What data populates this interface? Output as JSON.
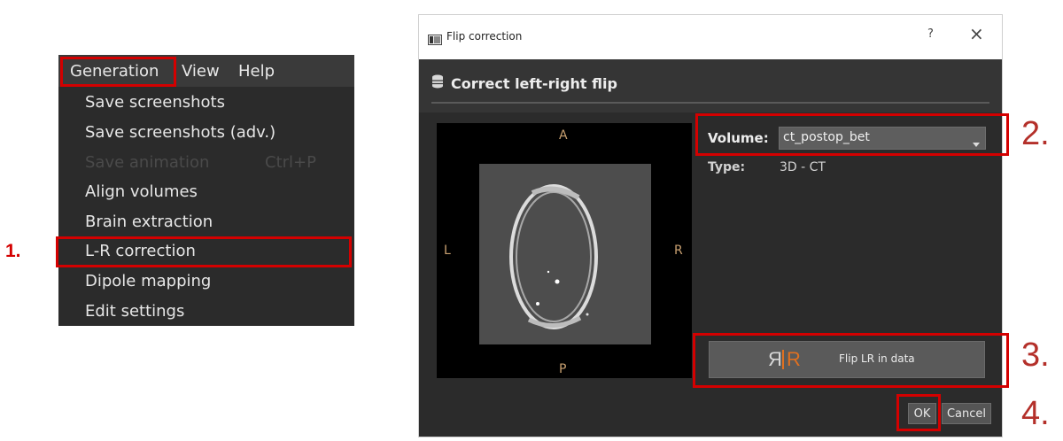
{
  "menu": {
    "bar": [
      "Generation",
      "View",
      "Help"
    ],
    "items": [
      {
        "label": "Save screenshots"
      },
      {
        "label": "Save screenshots (adv.)"
      },
      {
        "label": "Save animation",
        "shortcut": "Ctrl+P",
        "disabled": true
      },
      {
        "label": "Align volumes"
      },
      {
        "label": "Brain extraction"
      },
      {
        "label": "L-R correction"
      },
      {
        "label": "Dipole mapping"
      },
      {
        "label": "Edit settings"
      }
    ]
  },
  "steps": [
    "1.",
    "2.",
    "3.",
    "4."
  ],
  "dialog": {
    "title": "Flip correction",
    "help": "?",
    "close": "×",
    "header": "Correct left-right flip",
    "orient": {
      "top": "A",
      "bottom": "P",
      "left": "L",
      "right": "R"
    },
    "volume_label": "Volume:",
    "volume_value": "ct_postop_bet",
    "type_label": "Type:",
    "type_value": "3D - CT",
    "flip_icon_mirror": "Я",
    "flip_icon_r": "R",
    "flip_label": "Flip LR in data",
    "ok": "OK",
    "cancel": "Cancel"
  },
  "colors": {
    "highlight": "#d40000",
    "step_number": "#b4302a",
    "accent": "#e07020"
  }
}
